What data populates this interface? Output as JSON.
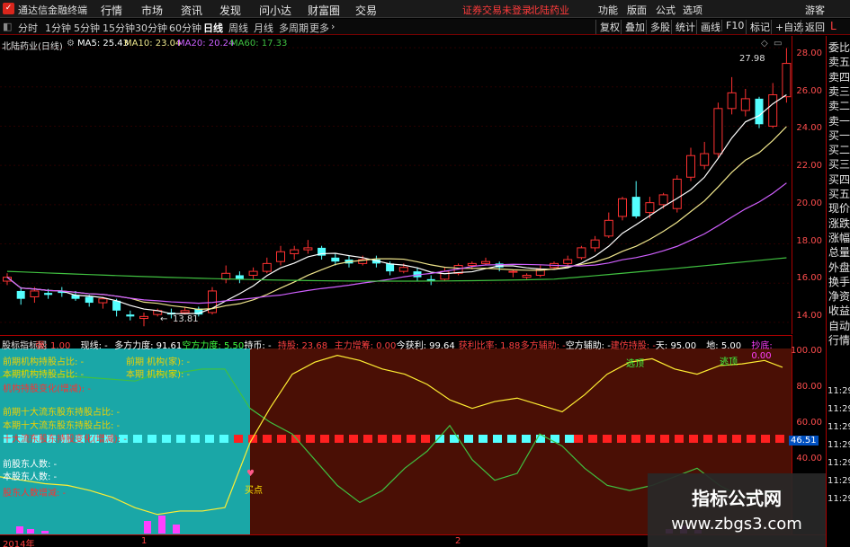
{
  "titlebar": {
    "app_name": "通达信金融终端",
    "menus": [
      "行情",
      "市场",
      "资讯",
      "发现",
      "问小达",
      "财富圈",
      "交易"
    ],
    "warning": "证券交易未登录",
    "stock_name": "北陆药业",
    "buttons": [
      "功能",
      "版面",
      "公式",
      "选项"
    ],
    "guest": "游客"
  },
  "toolbar": {
    "timeframes": [
      "分时",
      "1分钟",
      "5分钟",
      "15分钟",
      "30分钟",
      "60分钟",
      "日线",
      "周线",
      "月线",
      "多周期",
      "更多"
    ],
    "active": "日线",
    "right_buttons": [
      "复权",
      "叠加",
      "多股",
      "统计",
      "画线",
      "F10",
      "标记",
      "+自选",
      "返回"
    ]
  },
  "kline": {
    "title": "北陆药业(日线)",
    "ma": [
      {
        "label": "MA5: 25.43",
        "color": "#ffffff"
      },
      {
        "label": "MA10: 23.04",
        "color": "#f0e68c"
      },
      {
        "label": "MA20: 20.24",
        "color": "#d060ff"
      },
      {
        "label": "MA60: 17.33",
        "color": "#40c040"
      }
    ],
    "high_mark": "27.98",
    "low_mark": "13.81",
    "y_ticks": [
      "28.00",
      "26.00",
      "24.00",
      "22.00",
      "20.00",
      "18.00",
      "16.00",
      "14.00"
    ]
  },
  "indicator": {
    "header": [
      {
        "t": "股标指标网",
        "c": "#e0e0e0"
      },
      {
        "t": "强: 1.00",
        "c": "#ff4040"
      },
      {
        "t": "现线: -",
        "c": "#ffffff"
      },
      {
        "t": "多方力度: 91.61",
        "c": "#ffffff"
      },
      {
        "t": "空方力度: 5.50",
        "c": "#40ff40"
      },
      {
        "t": "持币: -",
        "c": "#ffffff"
      },
      {
        "t": "持股: 23.68",
        "c": "#ff4040"
      },
      {
        "t": "主力增筹: 0.00",
        "c": "#ff4040"
      },
      {
        "t": "今获利: 99.64",
        "c": "#ffffff"
      },
      {
        "t": "获利比率: 1.88",
        "c": "#ff4040"
      },
      {
        "t": "多方辅助: -",
        "c": "#ff4040"
      },
      {
        "t": "空方辅助: -",
        "c": "#ffffff"
      },
      {
        "t": "建仿持股: -",
        "c": "#ff4040"
      },
      {
        "t": "天: 95.00",
        "c": "#ffffff"
      },
      {
        "t": "地: 5.00",
        "c": "#ffffff"
      },
      {
        "t": "抄底: 0.00",
        "c": "#ff40ff"
      }
    ],
    "info_left": [
      {
        "t": "前期机构持股占比: -",
        "c": "#f0d000"
      },
      {
        "t": "本期机构持股占比: -",
        "c": "#f0d000"
      },
      {
        "t": "机构持股变化(增减): -",
        "c": "#ff3030"
      },
      {
        "t": "前期十大流东股东持股占比: -",
        "c": "#f0d000"
      },
      {
        "t": "本期十大流东股东持股占比: -",
        "c": "#f0d000"
      },
      {
        "t": "十大流东股东持股变化(增减): -",
        "c": "#ff3030"
      },
      {
        "t": "前股东人数: -",
        "c": "#ffffff"
      },
      {
        "t": "本股东人数: -",
        "c": "#ffffff"
      },
      {
        "t": "股东人数增减: -",
        "c": "#ff3030"
      }
    ],
    "info_right": [
      {
        "t": "前期 机构(家): -",
        "c": "#f0d000"
      },
      {
        "t": "本期 机构(家): -",
        "c": "#f0d000"
      }
    ],
    "labels": {
      "buy": "买点",
      "top1": "选顶",
      "top2": "逃顶"
    },
    "y_ticks": [
      "100.00",
      "80.00",
      "60.00",
      "40.00"
    ],
    "current_value": "46.51"
  },
  "bottom": {
    "year": "2014年",
    "marks": [
      "1",
      "2"
    ]
  },
  "right_side": {
    "top_label": "L",
    "items": [
      "委比",
      "卖五",
      "卖四",
      "卖三",
      "卖二",
      "卖一",
      "买一",
      "买二",
      "买三",
      "买四",
      "买五",
      "现价",
      "涨跌",
      "涨幅",
      "总量",
      "外盘",
      "换手",
      "净资",
      "收益",
      "自动",
      "行情"
    ],
    "times": [
      "11:29",
      "11:29",
      "11:29",
      "11:29",
      "11:29",
      "11:29",
      "11:29"
    ]
  },
  "watermark": {
    "line1": "指标公式网",
    "line2": "www.zbgs3.com"
  }
}
